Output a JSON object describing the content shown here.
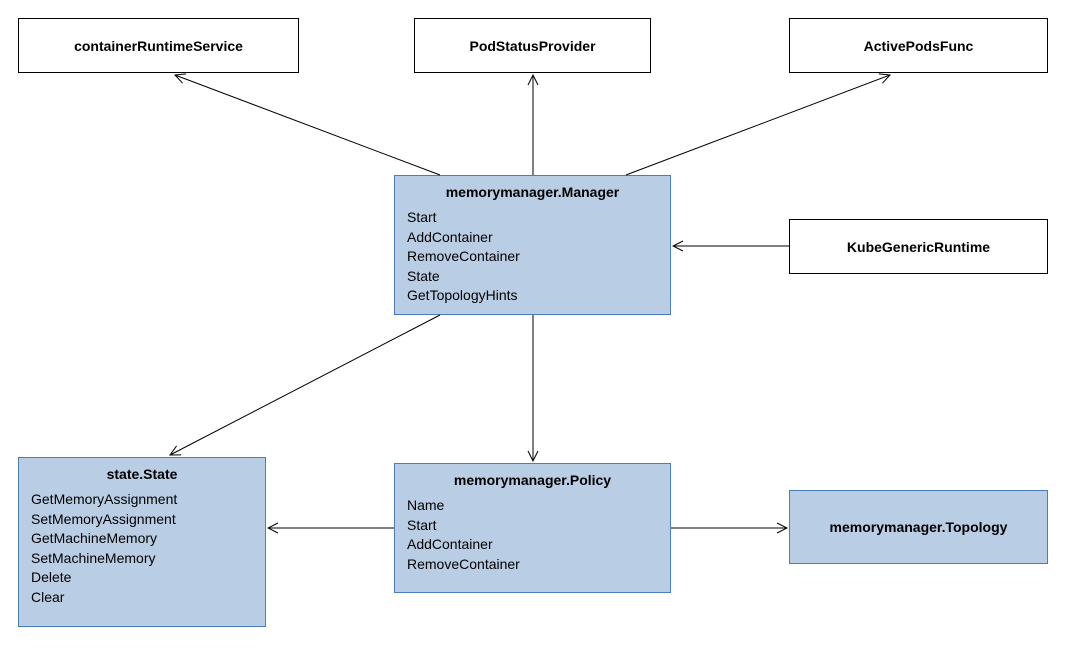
{
  "boxes": {
    "container_runtime_service": {
      "title": "containerRuntimeService"
    },
    "pod_status_provider": {
      "title": "PodStatusProvider"
    },
    "active_pods_func": {
      "title": "ActivePodsFunc"
    },
    "kube_generic_runtime": {
      "title": "KubeGenericRuntime"
    },
    "manager": {
      "title": "memorymanager.Manager",
      "methods": [
        "Start",
        "AddContainer",
        "RemoveContainer",
        "State",
        "GetTopologyHints"
      ]
    },
    "state": {
      "title": "state.State",
      "methods": [
        "GetMemoryAssignment",
        "SetMemoryAssignment",
        "GetMachineMemory",
        "SetMachineMemory",
        "Delete",
        "Clear"
      ]
    },
    "policy": {
      "title": "memorymanager.Policy",
      "methods": [
        "Name",
        "Start",
        "AddContainer",
        "RemoveContainer"
      ]
    },
    "topology": {
      "title": "memorymanager.Topology"
    }
  },
  "chart_data": {
    "type": "diagram",
    "nodes": [
      {
        "id": "containerRuntimeService",
        "kind": "external"
      },
      {
        "id": "PodStatusProvider",
        "kind": "external"
      },
      {
        "id": "ActivePodsFunc",
        "kind": "external"
      },
      {
        "id": "KubeGenericRuntime",
        "kind": "external"
      },
      {
        "id": "memorymanager.Manager",
        "kind": "class",
        "methods": [
          "Start",
          "AddContainer",
          "RemoveContainer",
          "State",
          "GetTopologyHints"
        ]
      },
      {
        "id": "state.State",
        "kind": "class",
        "methods": [
          "GetMemoryAssignment",
          "SetMemoryAssignment",
          "GetMachineMemory",
          "SetMachineMemory",
          "Delete",
          "Clear"
        ]
      },
      {
        "id": "memorymanager.Policy",
        "kind": "class",
        "methods": [
          "Name",
          "Start",
          "AddContainer",
          "RemoveContainer"
        ]
      },
      {
        "id": "memorymanager.Topology",
        "kind": "class"
      }
    ],
    "edges": [
      {
        "from": "memorymanager.Manager",
        "to": "containerRuntimeService"
      },
      {
        "from": "memorymanager.Manager",
        "to": "PodStatusProvider"
      },
      {
        "from": "memorymanager.Manager",
        "to": "ActivePodsFunc"
      },
      {
        "from": "KubeGenericRuntime",
        "to": "memorymanager.Manager"
      },
      {
        "from": "memorymanager.Manager",
        "to": "state.State"
      },
      {
        "from": "memorymanager.Manager",
        "to": "memorymanager.Policy"
      },
      {
        "from": "memorymanager.Policy",
        "to": "state.State"
      },
      {
        "from": "memorymanager.Policy",
        "to": "memorymanager.Topology"
      }
    ]
  }
}
